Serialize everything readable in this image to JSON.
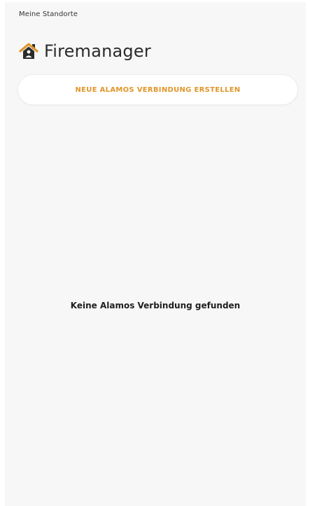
{
  "header": {
    "breadcrumb": "Meine Standorte",
    "title": "Firemanager",
    "title_icon": "home-icon"
  },
  "actions": {
    "new_connection_label": "NEUE ALAMOS VERBINDUNG ERSTELLEN"
  },
  "main": {
    "empty_message": "Keine Alamos Verbindung gefunden"
  },
  "colors": {
    "accent": "#e0962a",
    "background": "#f7f7f7",
    "text": "#2b2b2b"
  }
}
